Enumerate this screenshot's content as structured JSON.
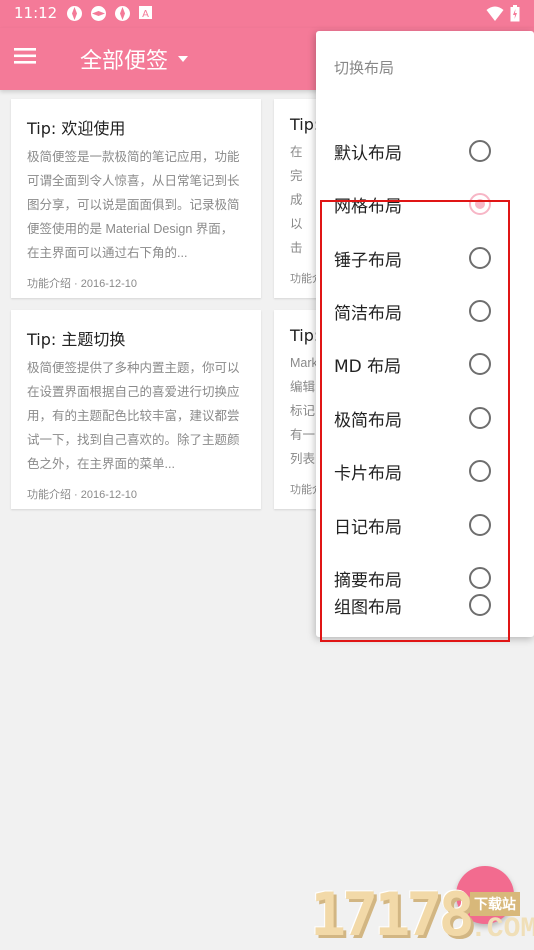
{
  "status": {
    "time": "11:12",
    "icons_left": [
      "app-notification-icon",
      "app-notification-icon",
      "app-notification-icon",
      "a-icon"
    ],
    "icons_right": [
      "wifi-icon",
      "battery-icon"
    ]
  },
  "appbar": {
    "title": "全部便签",
    "color": "#f47a98"
  },
  "notes": [
    {
      "title": "Tip: 欢迎使用",
      "body": "极简便签是一款极简的笔记应用，功能可谓全面到令人惊喜，从日常笔记到长图分享，可以说是面面俱到。记录极简便签使用的是 Material Design 界面，在主界面可以通过右下角的...",
      "meta": "功能介绍 · 2016-12-10"
    },
    {
      "title": "Tip:",
      "body": "在完成以击编\"预览以定",
      "meta": "功能介"
    },
    {
      "title": "Tip: 主题切换",
      "body": "极简便签提供了多种内置主题，你可以在设置界面根据自己的喜爱进行切换应用，有的主题配色比较丰富，建议都尝试一下，找到自己喜欢的。除了主题颜色之外，在主界面的菜单...",
      "meta": "功能介绍 · 2016-12-10"
    },
    {
      "title": "Tip:",
      "body": "Mark编辑标记有一列表",
      "meta": "功能介"
    }
  ],
  "layout_menu": {
    "header": "切换布局",
    "items": [
      {
        "label": "默认布局",
        "checked": false
      },
      {
        "label": "网格布局",
        "checked": true
      },
      {
        "label": "锤子布局",
        "checked": false
      },
      {
        "label": "简洁布局",
        "checked": false
      },
      {
        "label": "MD 布局",
        "checked": false
      },
      {
        "label": "极简布局",
        "checked": false
      },
      {
        "label": "卡片布局",
        "checked": false
      },
      {
        "label": "日记布局",
        "checked": false
      },
      {
        "label": "摘要布局",
        "checked": false
      },
      {
        "label": "组图布局",
        "checked": false
      }
    ]
  },
  "watermark": {
    "number": "17178",
    "badge": "下载站",
    "suffix": ".COM"
  },
  "colors": {
    "accent": "#f47a98",
    "highlight": "#e01515",
    "radio_checked": "#f7b6c6"
  }
}
